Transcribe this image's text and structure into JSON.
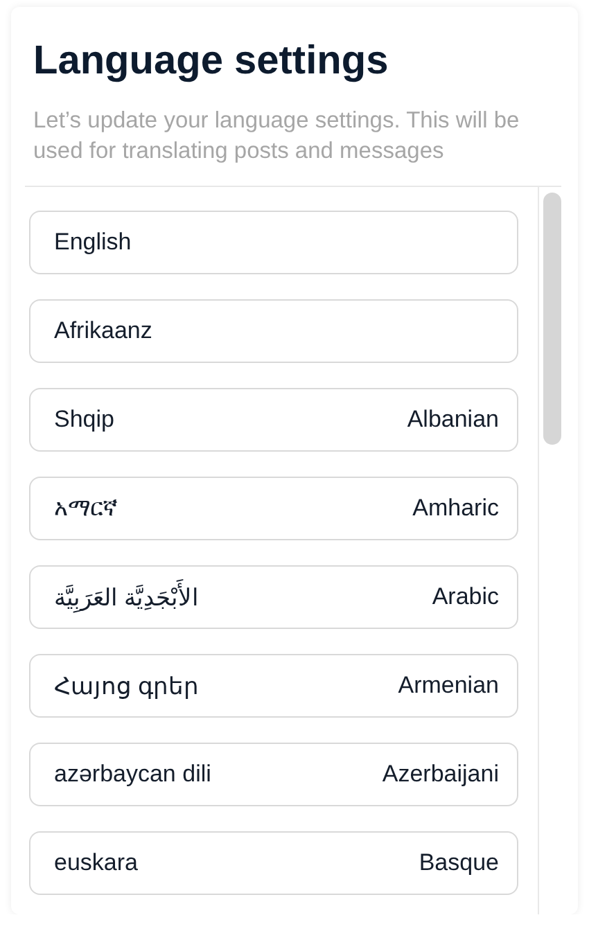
{
  "title": "Language settings",
  "subtitle": "Let’s update your language settings. This will be used for translating posts and messages",
  "languages": [
    {
      "name": "English"
    },
    {
      "name": "Afrikaanz"
    },
    {
      "name": "Shqip",
      "english": "Albanian"
    },
    {
      "name": "አማርኛ",
      "english": "Amharic"
    },
    {
      "name": "الأَبْجَدِيَّة العَرَبِيَّة",
      "english": "Arabic"
    },
    {
      "name": "Հայոց գրեր",
      "english": "Armenian"
    },
    {
      "name": "azərbaycan dili",
      "english": "Azerbaijani"
    },
    {
      "name": "euskara",
      "english": "Basque"
    }
  ]
}
